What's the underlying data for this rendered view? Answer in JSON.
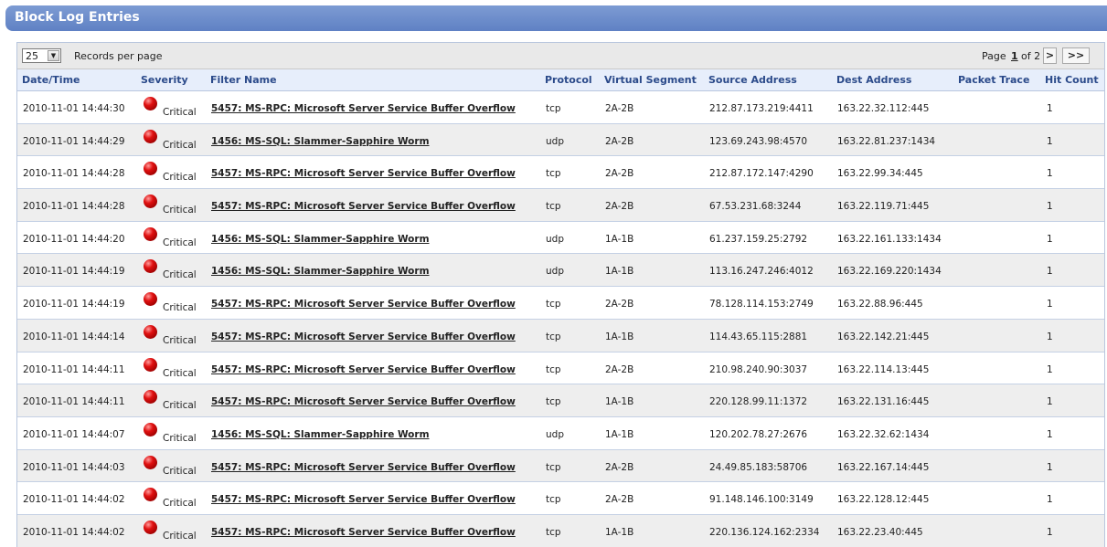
{
  "page": {
    "title": "Block Log Entries"
  },
  "toolbar": {
    "records_per_page_value": "25",
    "records_per_page_label": "Records per page"
  },
  "pager": {
    "prefix": "Page",
    "current": "1",
    "of_label": "of 2",
    "next_label": ">",
    "last_label": ">>"
  },
  "columns": [
    "Date/Time",
    "Severity",
    "Filter Name",
    "Protocol",
    "Virtual Segment",
    "Source Address",
    "Dest Address",
    "Packet Trace",
    "Hit Count"
  ],
  "rows": [
    {
      "datetime": "2010-11-01 14:44:30",
      "severity": "Critical",
      "filter": "5457: MS-RPC: Microsoft Server Service Buffer Overflow",
      "protocol": "tcp",
      "segment": "2A-2B",
      "source": "212.87.173.219:4411",
      "dest": "163.22.32.112:445",
      "trace": "",
      "hits": "1"
    },
    {
      "datetime": "2010-11-01 14:44:29",
      "severity": "Critical",
      "filter": "1456: MS-SQL: Slammer-Sapphire Worm",
      "protocol": "udp",
      "segment": "2A-2B",
      "source": "123.69.243.98:4570",
      "dest": "163.22.81.237:1434",
      "trace": "",
      "hits": "1"
    },
    {
      "datetime": "2010-11-01 14:44:28",
      "severity": "Critical",
      "filter": "5457: MS-RPC: Microsoft Server Service Buffer Overflow",
      "protocol": "tcp",
      "segment": "2A-2B",
      "source": "212.87.172.147:4290",
      "dest": "163.22.99.34:445",
      "trace": "",
      "hits": "1"
    },
    {
      "datetime": "2010-11-01 14:44:28",
      "severity": "Critical",
      "filter": "5457: MS-RPC: Microsoft Server Service Buffer Overflow",
      "protocol": "tcp",
      "segment": "2A-2B",
      "source": "67.53.231.68:3244",
      "dest": "163.22.119.71:445",
      "trace": "",
      "hits": "1"
    },
    {
      "datetime": "2010-11-01 14:44:20",
      "severity": "Critical",
      "filter": "1456: MS-SQL: Slammer-Sapphire Worm",
      "protocol": "udp",
      "segment": "1A-1B",
      "source": "61.237.159.25:2792",
      "dest": "163.22.161.133:1434",
      "trace": "",
      "hits": "1"
    },
    {
      "datetime": "2010-11-01 14:44:19",
      "severity": "Critical",
      "filter": "1456: MS-SQL: Slammer-Sapphire Worm",
      "protocol": "udp",
      "segment": "1A-1B",
      "source": "113.16.247.246:4012",
      "dest": "163.22.169.220:1434",
      "trace": "",
      "hits": "1"
    },
    {
      "datetime": "2010-11-01 14:44:19",
      "severity": "Critical",
      "filter": "5457: MS-RPC: Microsoft Server Service Buffer Overflow",
      "protocol": "tcp",
      "segment": "2A-2B",
      "source": "78.128.114.153:2749",
      "dest": "163.22.88.96:445",
      "trace": "",
      "hits": "1"
    },
    {
      "datetime": "2010-11-01 14:44:14",
      "severity": "Critical",
      "filter": "5457: MS-RPC: Microsoft Server Service Buffer Overflow",
      "protocol": "tcp",
      "segment": "1A-1B",
      "source": "114.43.65.115:2881",
      "dest": "163.22.142.21:445",
      "trace": "",
      "hits": "1"
    },
    {
      "datetime": "2010-11-01 14:44:11",
      "severity": "Critical",
      "filter": "5457: MS-RPC: Microsoft Server Service Buffer Overflow",
      "protocol": "tcp",
      "segment": "2A-2B",
      "source": "210.98.240.90:3037",
      "dest": "163.22.114.13:445",
      "trace": "",
      "hits": "1"
    },
    {
      "datetime": "2010-11-01 14:44:11",
      "severity": "Critical",
      "filter": "5457: MS-RPC: Microsoft Server Service Buffer Overflow",
      "protocol": "tcp",
      "segment": "1A-1B",
      "source": "220.128.99.11:1372",
      "dest": "163.22.131.16:445",
      "trace": "",
      "hits": "1"
    },
    {
      "datetime": "2010-11-01 14:44:07",
      "severity": "Critical",
      "filter": "1456: MS-SQL: Slammer-Sapphire Worm",
      "protocol": "udp",
      "segment": "1A-1B",
      "source": "120.202.78.27:2676",
      "dest": "163.22.32.62:1434",
      "trace": "",
      "hits": "1"
    },
    {
      "datetime": "2010-11-01 14:44:03",
      "severity": "Critical",
      "filter": "5457: MS-RPC: Microsoft Server Service Buffer Overflow",
      "protocol": "tcp",
      "segment": "2A-2B",
      "source": "24.49.85.183:58706",
      "dest": "163.22.167.14:445",
      "trace": "",
      "hits": "1"
    },
    {
      "datetime": "2010-11-01 14:44:02",
      "severity": "Critical",
      "filter": "5457: MS-RPC: Microsoft Server Service Buffer Overflow",
      "protocol": "tcp",
      "segment": "2A-2B",
      "source": "91.148.146.100:3149",
      "dest": "163.22.128.12:445",
      "trace": "",
      "hits": "1"
    },
    {
      "datetime": "2010-11-01 14:44:02",
      "severity": "Critical",
      "filter": "5457: MS-RPC: Microsoft Server Service Buffer Overflow",
      "protocol": "tcp",
      "segment": "1A-1B",
      "source": "220.136.124.162:2334",
      "dest": "163.22.23.40:445",
      "trace": "",
      "hits": "1"
    }
  ],
  "colors": {
    "title_bar": "#6a8cc8",
    "header_text": "#2b4a8a",
    "critical": "#d40000"
  }
}
